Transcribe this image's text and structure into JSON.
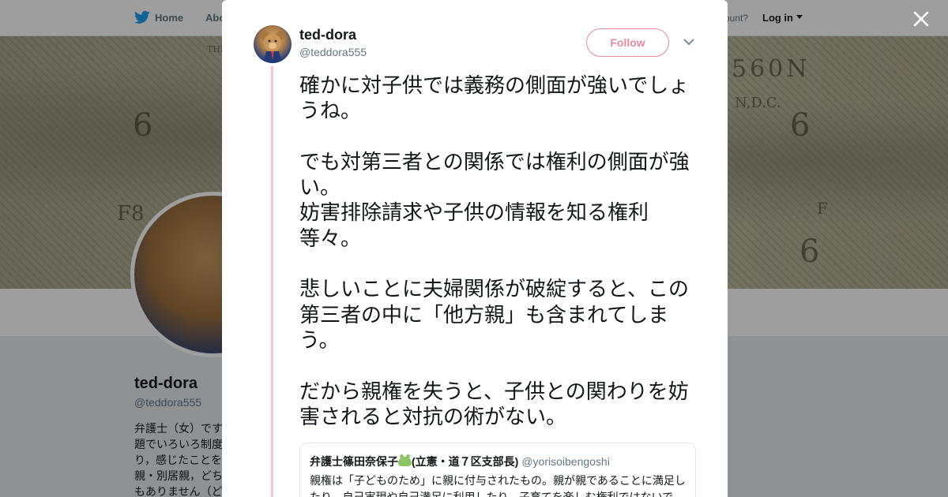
{
  "topbar": {
    "home_label": "Home",
    "about_label": "Abo",
    "account_prompt": "ccount?",
    "login_label": "Log in"
  },
  "banner": {
    "numerals_left": "6",
    "numerals_right": "6",
    "serial": "560N",
    "location": "N,D.C.",
    "code_left": "F8",
    "code_right": "F",
    "fine_print": "THI"
  },
  "profile": {
    "name": "ted-dora",
    "handle": "@teddora555",
    "bio": "弁護士（女）です題でいろいろ制度り，感じたことを親・別居親，どちもありません（ど"
  },
  "modal": {
    "close_label": "×",
    "author_name": "ted-dora",
    "author_handle": "@teddora555",
    "follow_label": "Follow",
    "tweet_paragraphs": [
      "確かに対子供では義務の側面が強いでしょうね。",
      "",
      "でも対第三者との関係では権利の側面が強い。",
      "妨害排除請求や子供の情報を知る権利等々。",
      "",
      "悲しいことに夫婦関係が破綻すると、この第三者の中に「他方親」も含まれてしまう。",
      "",
      "だから親権を失うと、子供との関わりを妨害されると対抗の術がない。"
    ],
    "quote": {
      "name_before_emoji": "弁護士篠田奈保子",
      "name_after_emoji": "(立憲・道７区支部長)",
      "handle": "@yorisoibengoshi",
      "text": "親権は「子どものため」に親に付与されたもの。親が親であることに満足したり、自己実現や自己満足に利用したり、子育てを楽しむ権利ではないで"
    }
  },
  "colors": {
    "follow_accent": "#e98aa1",
    "thread_line": "#f5c7d3",
    "twitter_blue": "#1da1f2"
  }
}
